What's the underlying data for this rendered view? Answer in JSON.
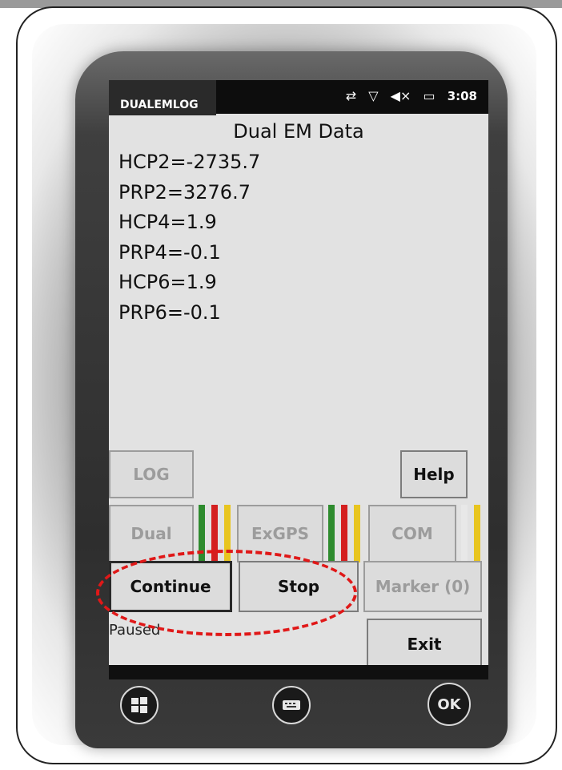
{
  "status_bar": {
    "app_name": "DUALEMLOG",
    "time": "3:08",
    "icons": [
      "sync-off-icon",
      "signal-off-icon",
      "speaker-muted-icon",
      "battery-icon"
    ]
  },
  "screen": {
    "title": "Dual EM Data",
    "readings": [
      "HCP2=-2735.7",
      "PRP2=3276.7",
      "HCP4=1.9",
      "PRP4=-0.1",
      "HCP6=1.9",
      "PRP6=-0.1"
    ],
    "status_text": "Paused"
  },
  "buttons": {
    "log": "LOG",
    "help": "Help",
    "dual": "Dual",
    "exgps": "ExGPS",
    "com": "COM",
    "continue": "Continue",
    "stop": "Stop",
    "marker": "Marker (0)",
    "exit": "Exit"
  },
  "indicator_colors": {
    "dual": [
      "#2e8b2e",
      "#d42020",
      "#e8c520"
    ],
    "exgps": [
      "#2e8b2e",
      "#d42020",
      "#e8c520"
    ],
    "com": [
      "#e8e8e8",
      "#e8c520"
    ]
  },
  "soft_keys": {
    "start": "windows-start-icon",
    "keyboard": "keyboard-icon",
    "ok": "OK"
  },
  "annotation_color": "#e01818"
}
